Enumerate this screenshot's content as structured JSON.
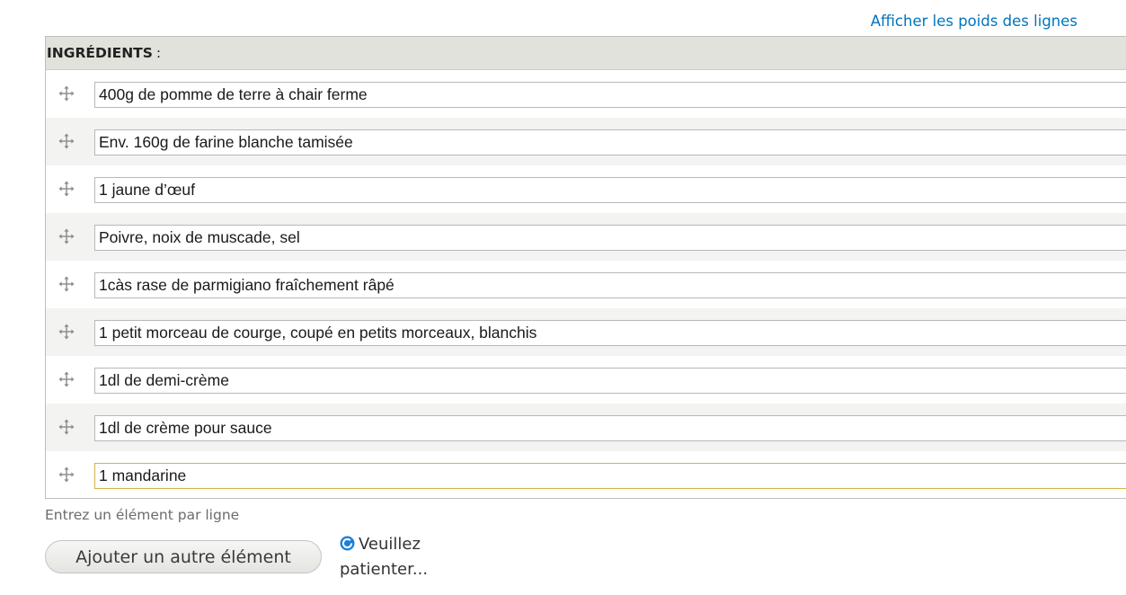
{
  "header": {
    "toggle_weights_label": "Afficher les poids des lignes"
  },
  "table": {
    "title": "INGRÉDIENTS",
    "title_suffix": ":",
    "items": [
      "400g de pomme de terre à chair ferme",
      "Env. 160g de farine blanche tamisée",
      "1 jaune d’œuf",
      "Poivre, noix de muscade, sel",
      "1càs rase de parmigiano fraîchement râpé",
      "1 petit morceau de courge, coupé en petits morceaux, blanchis",
      "1dl de demi-crème",
      "1dl de crème pour sauce",
      "1 mandarine"
    ],
    "focused_item_index": 8
  },
  "help_text": "Entrez un élément par ligne",
  "add_button_label": "Ajouter un autre élément",
  "throbber": {
    "icon": "spinner-icon",
    "line1": "Veuillez",
    "line2": "patienter..."
  },
  "colors": {
    "link": "#0074bd",
    "header_bg": "#e2e2dc",
    "row_alt_bg": "#f3f3f1",
    "focus_border": "#d2b24c",
    "spinner": "#1e7fd6"
  }
}
